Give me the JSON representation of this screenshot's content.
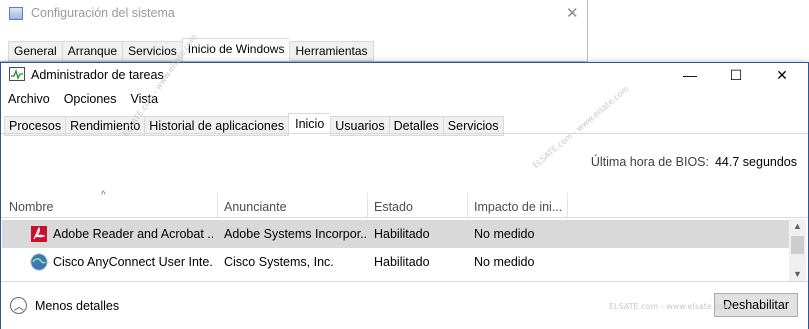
{
  "background_window": {
    "title": "Configuración del sistema",
    "close_glyph": "✕",
    "tabs": [
      {
        "label": "General",
        "active": false
      },
      {
        "label": "Arranque",
        "active": false
      },
      {
        "label": "Servicios",
        "active": false
      },
      {
        "label": "Inicio de Windows",
        "active": true
      },
      {
        "label": "Herramientas",
        "active": false
      }
    ]
  },
  "window": {
    "title": "Administrador de tareas",
    "controls": {
      "minimize": "—",
      "maximize": "☐",
      "close": "✕"
    }
  },
  "menu": [
    "Archivo",
    "Opciones",
    "Vista"
  ],
  "tabs": [
    {
      "label": "Procesos",
      "active": false
    },
    {
      "label": "Rendimiento",
      "active": false
    },
    {
      "label": "Historial de aplicaciones",
      "active": false
    },
    {
      "label": "Inicio",
      "active": true
    },
    {
      "label": "Usuarios",
      "active": false
    },
    {
      "label": "Detalles",
      "active": false
    },
    {
      "label": "Servicios",
      "active": false
    }
  ],
  "bios": {
    "label": "Última hora de BIOS:",
    "value": "44.7 segundos"
  },
  "table": {
    "sort_glyph": "^",
    "columns": [
      "Nombre",
      "Anunciante",
      "Estado",
      "Impacto de ini..."
    ],
    "rows": [
      {
        "name": "Adobe Reader and Acrobat ...",
        "publisher": "Adobe Systems Incorpor...",
        "status": "Habilitado",
        "impact": "No medido",
        "icon": "adobe-acrobat-icon",
        "selected": true
      },
      {
        "name": "Cisco AnyConnect User Inte...",
        "publisher": "Cisco Systems, Inc.",
        "status": "Habilitado",
        "impact": "No medido",
        "icon": "cisco-anyconnect-icon",
        "selected": false
      }
    ]
  },
  "footer": {
    "less_details": "Menos detalles",
    "disable_button": "Deshabilitar"
  },
  "watermark": "ELSATE.com - www.elsate.com",
  "colors": {
    "accent_border": "#2b579a",
    "selected_row": "#d9d9d9",
    "adobe_red": "#c8102e"
  }
}
